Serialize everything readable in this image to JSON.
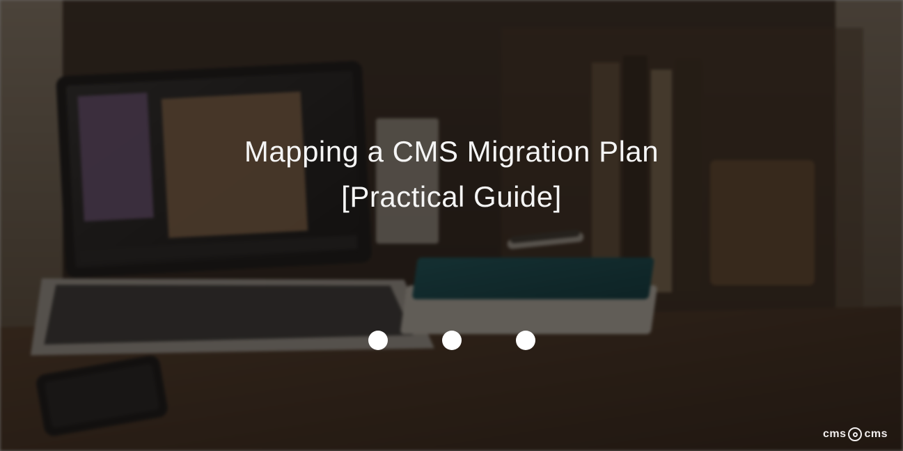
{
  "hero": {
    "title_line_1": "Mapping a CMS Migration Plan",
    "title_line_2": "[Practical Guide]"
  },
  "carousel": {
    "dot_count": 3
  },
  "logo": {
    "part1": "cms",
    "part2": "cms"
  }
}
